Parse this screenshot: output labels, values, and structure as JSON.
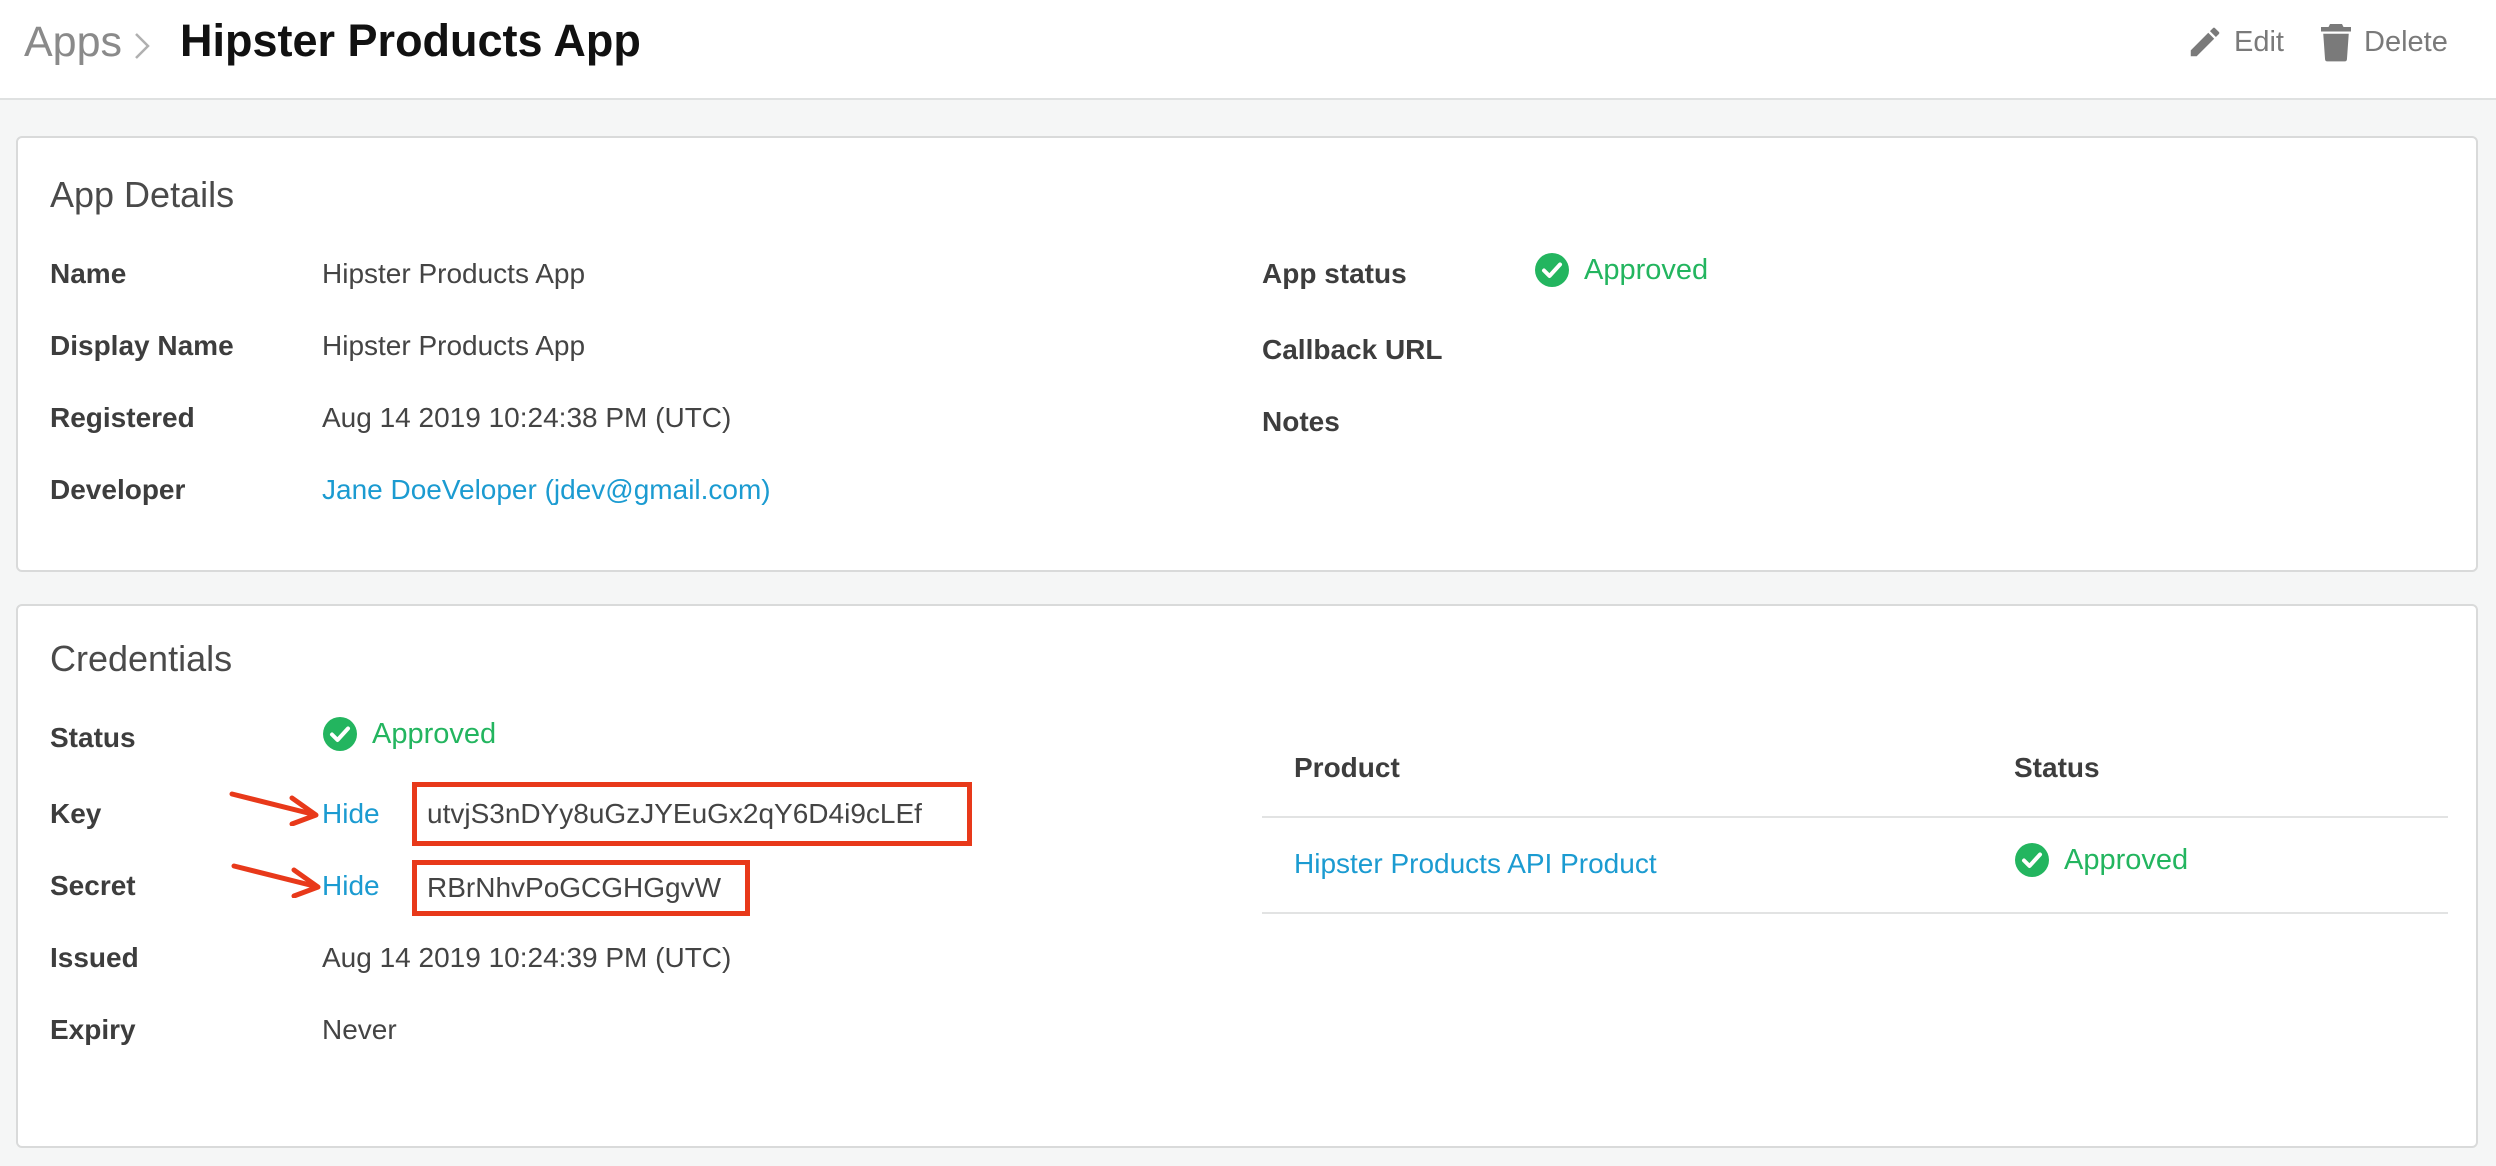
{
  "header": {
    "breadcrumb_root": "Apps",
    "title": "Hipster Products App",
    "edit_label": "Edit",
    "delete_label": "Delete"
  },
  "app_details": {
    "heading": "App Details",
    "name_label": "Name",
    "name_value": "Hipster Products App",
    "display_name_label": "Display Name",
    "display_name_value": "Hipster Products App",
    "registered_label": "Registered",
    "registered_value": "Aug 14 2019 10:24:38 PM (UTC)",
    "developer_label": "Developer",
    "developer_value": "Jane DoeVeloper (jdev@gmail.com)",
    "app_status_label": "App status",
    "app_status_value": "Approved",
    "callback_url_label": "Callback URL",
    "notes_label": "Notes"
  },
  "credentials": {
    "heading": "Credentials",
    "status_label": "Status",
    "status_value": "Approved",
    "key_label": "Key",
    "key_toggle": "Hide",
    "key_value": "utvjS3nDYy8uGzJYEuGx2qY6D4i9cLEf",
    "secret_label": "Secret",
    "secret_toggle": "Hide",
    "secret_value": "RBrNhvPoGCGHGgvW",
    "issued_label": "Issued",
    "issued_value": "Aug 14 2019 10:24:39 PM (UTC)",
    "expiry_label": "Expiry",
    "expiry_value": "Never",
    "products_table": {
      "columns": [
        "Product",
        "Status"
      ],
      "rows": [
        {
          "product": "Hipster Products API Product",
          "status": "Approved"
        }
      ]
    }
  },
  "colors": {
    "link": "#1b9bd1",
    "approved": "#23b55f",
    "annotation_red": "#e8391a"
  },
  "icons": {
    "edit": "pencil-icon",
    "delete": "trash-icon",
    "status": "check-circle-icon",
    "breadcrumb_separator": "chevron-right-icon",
    "annotation": "arrow-icon"
  }
}
